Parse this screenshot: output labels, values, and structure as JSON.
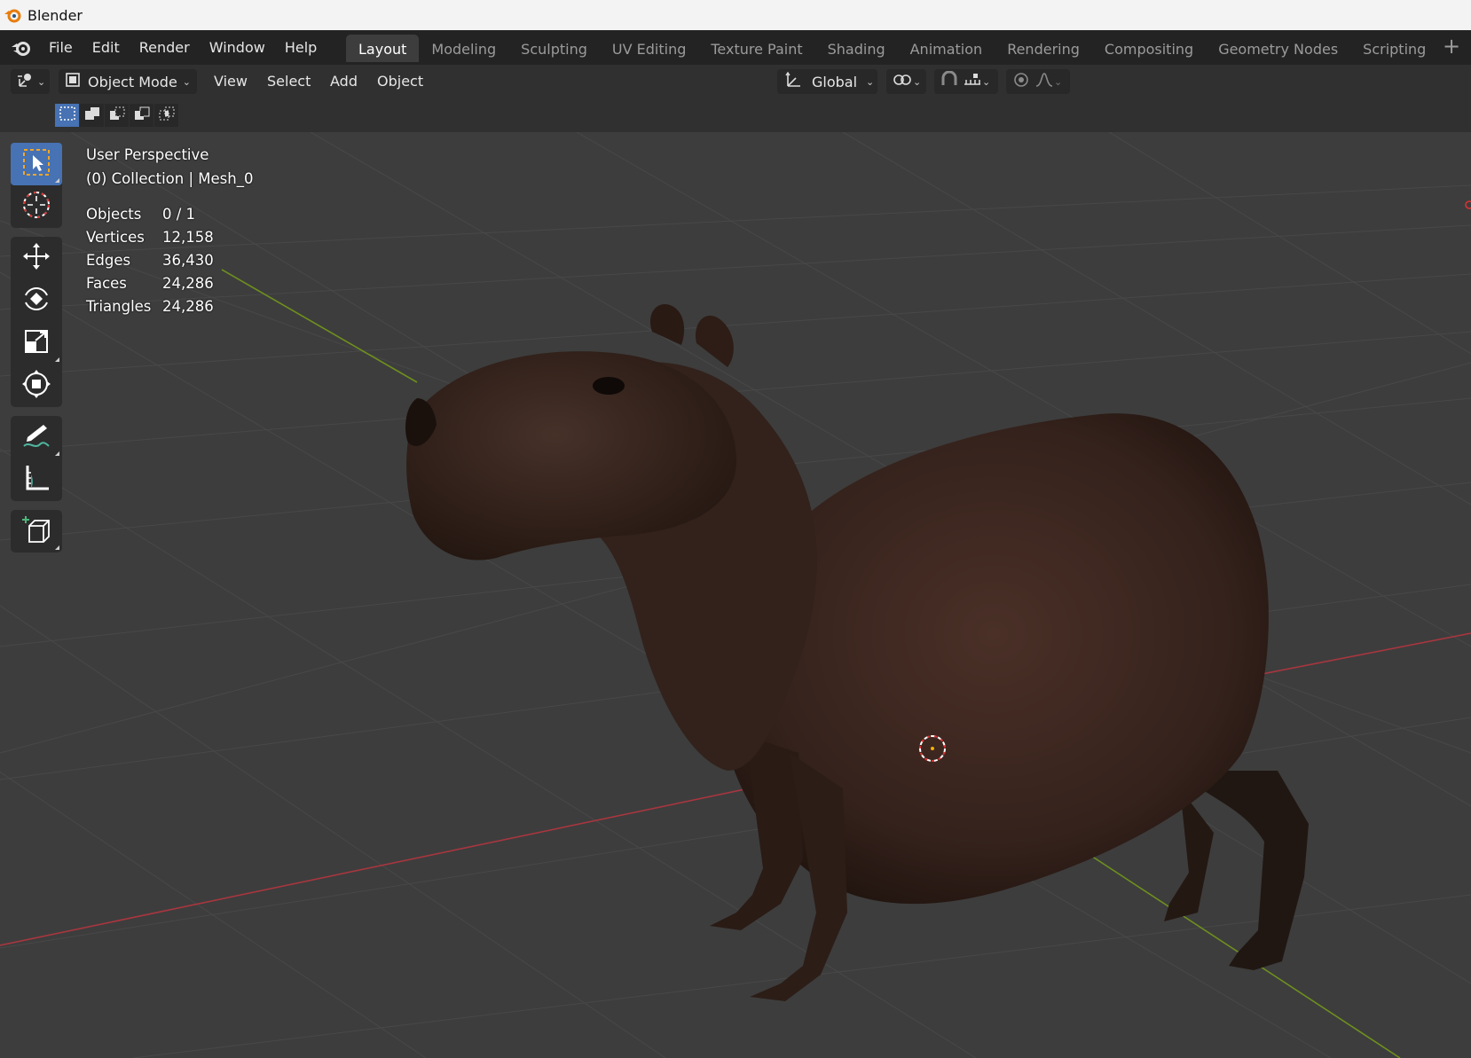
{
  "titlebar": {
    "title": "Blender",
    "icon": "blender-logo-icon"
  },
  "topbar": {
    "menus": [
      "File",
      "Edit",
      "Render",
      "Window",
      "Help"
    ],
    "workspaces": [
      "Layout",
      "Modeling",
      "Sculpting",
      "UV Editing",
      "Texture Paint",
      "Shading",
      "Animation",
      "Rendering",
      "Compositing",
      "Geometry Nodes",
      "Scripting"
    ],
    "active_workspace": "Layout",
    "add_label": "+"
  },
  "header": {
    "mode": "Object Mode",
    "menus": [
      "View",
      "Select",
      "Add",
      "Object"
    ],
    "orientation": "Global"
  },
  "viewport": {
    "perspective": "User Perspective",
    "collection": "(0) Collection | Mesh_0",
    "stats": [
      {
        "label": "Objects",
        "value": "0 / 1"
      },
      {
        "label": "Vertices",
        "value": "12,158"
      },
      {
        "label": "Edges",
        "value": "36,430"
      },
      {
        "label": "Faces",
        "value": "24,286"
      },
      {
        "label": "Triangles",
        "value": "24,286"
      }
    ],
    "object": "capybara-mesh"
  },
  "toolbar": {
    "tools": [
      "select-box-icon",
      "cursor-icon",
      "move-icon",
      "rotate-icon",
      "scale-icon",
      "transform-icon",
      "annotate-icon",
      "measure-icon",
      "add-cube-icon"
    ],
    "active_tool": "select-box-icon"
  },
  "colors": {
    "accent": "#4772b3",
    "viewport_bg": "#3d3d3d",
    "x_axis": "#b03c44",
    "y_axis": "#6e8f1e"
  }
}
